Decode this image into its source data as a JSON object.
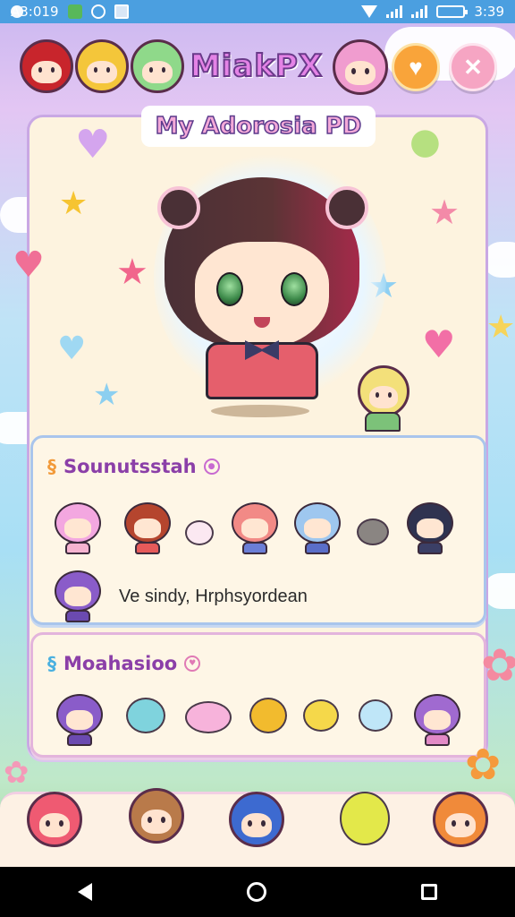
{
  "status_bar": {
    "time_left": "A3:019",
    "time_right": "3:39"
  },
  "header": {
    "title": "MiakPX",
    "subtitle": "My Adorosia PD"
  },
  "panel_1": {
    "title": "Sounutsstah",
    "text": "Ve sindy, Hrphsyordean"
  },
  "panel_2": {
    "title": "Moahasioo"
  },
  "icons": {
    "favorite": "heart-icon",
    "close": "close-icon",
    "back": "back-icon",
    "home": "home-icon",
    "recent": "recent-apps-icon"
  },
  "colors": {
    "status_bar": "#4b9fe0",
    "accent_orange": "#f9a43a",
    "accent_pink": "#f6a5c3",
    "title_purple": "#8b3fa8",
    "card_bg": "#fdf3df"
  }
}
